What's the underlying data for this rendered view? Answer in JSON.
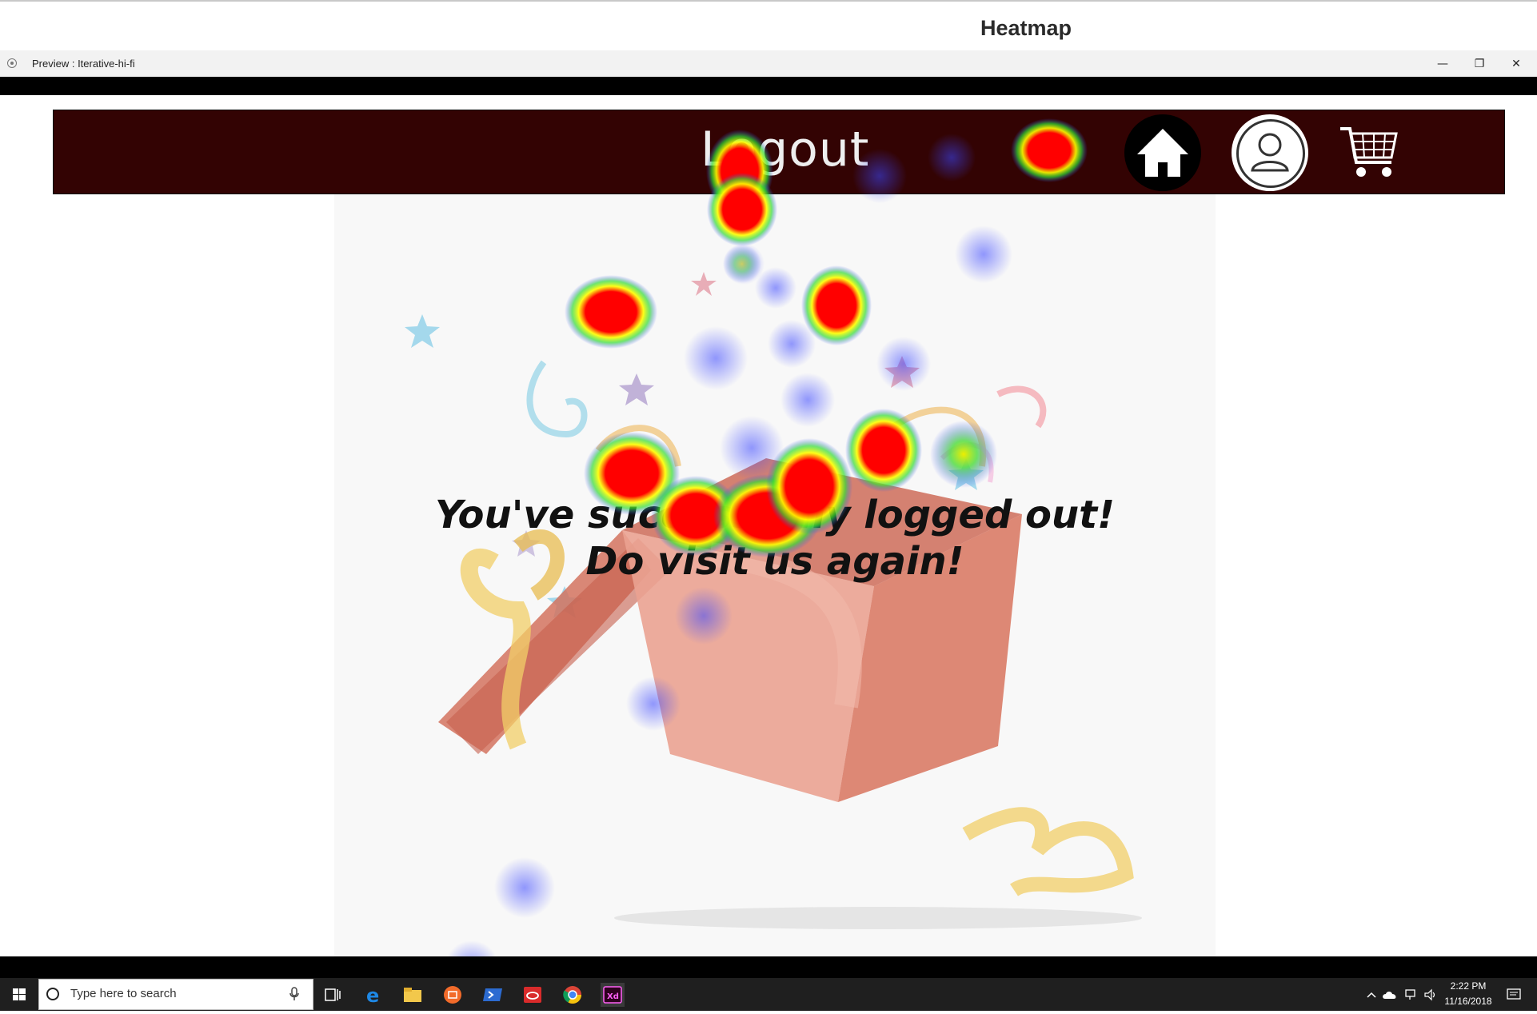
{
  "heatmap": {
    "title": "Heatmap"
  },
  "window": {
    "title": "Preview : Iterative-hi-fi",
    "minimize_glyph": "—",
    "maximize_glyph": "❐",
    "close_glyph": "✕"
  },
  "nav": {
    "logout_label": "Logout",
    "background_color": "#330303",
    "home_icon": "home-icon",
    "profile_icon": "user-profile-icon",
    "cart_icon": "shopping-cart-icon"
  },
  "message": {
    "line1": "You've successfully logged out!",
    "line2": "Do visit us again!"
  },
  "illustration": {
    "icon": "gift-box-confetti-icon"
  },
  "taskbar": {
    "search_placeholder": "Type here to search",
    "apps": [
      "start-icon",
      "task-view-icon",
      "edge-icon",
      "file-explorer-icon",
      "app-orange-icon",
      "powershell-icon",
      "creative-cloud-icon",
      "chrome-icon",
      "adobe-xd-icon"
    ],
    "time": "2:22 PM",
    "date": "11/16/2018"
  }
}
